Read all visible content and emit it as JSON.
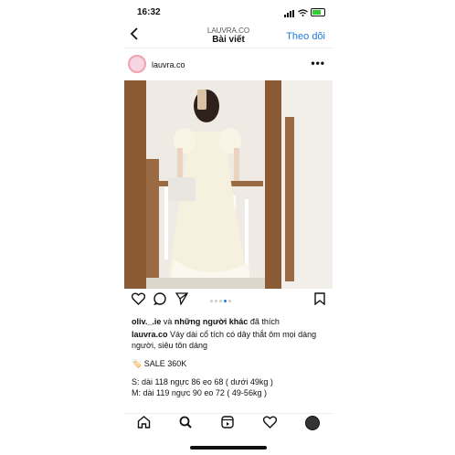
{
  "status_bar": {
    "time": "16:32"
  },
  "nav": {
    "subtitle": "LAUVRA.CO",
    "title": "Bài viết",
    "follow_label": "Theo dõi",
    "back_icon": "chevron-left-icon"
  },
  "post": {
    "handle": "lauvra.co",
    "more_icon": "ellipsis-icon"
  },
  "actions": {
    "carousel_dots": 5,
    "active_dot": 3
  },
  "likes": {
    "user": "oliv._.ie",
    "connector": " và ",
    "others": "những người khác",
    "suffix": " đã thích"
  },
  "caption": {
    "author": "lauvra.co",
    "text": " Váy dài cổ tích có dây thắt ôm mọi dáng người, siêu tôn dáng",
    "sale_emoji": "🏷️",
    "sale": "SALE 360K",
    "size_s": "S: dài 118 ngực 86 eo 68 ( dưới 49kg )",
    "size_m": "M: dài 119 ngực 90 eo 72 ( 49-56kg )"
  },
  "tabbar": [
    "home-icon",
    "search-icon",
    "reels-icon",
    "heart-icon",
    "profile-avatar"
  ]
}
